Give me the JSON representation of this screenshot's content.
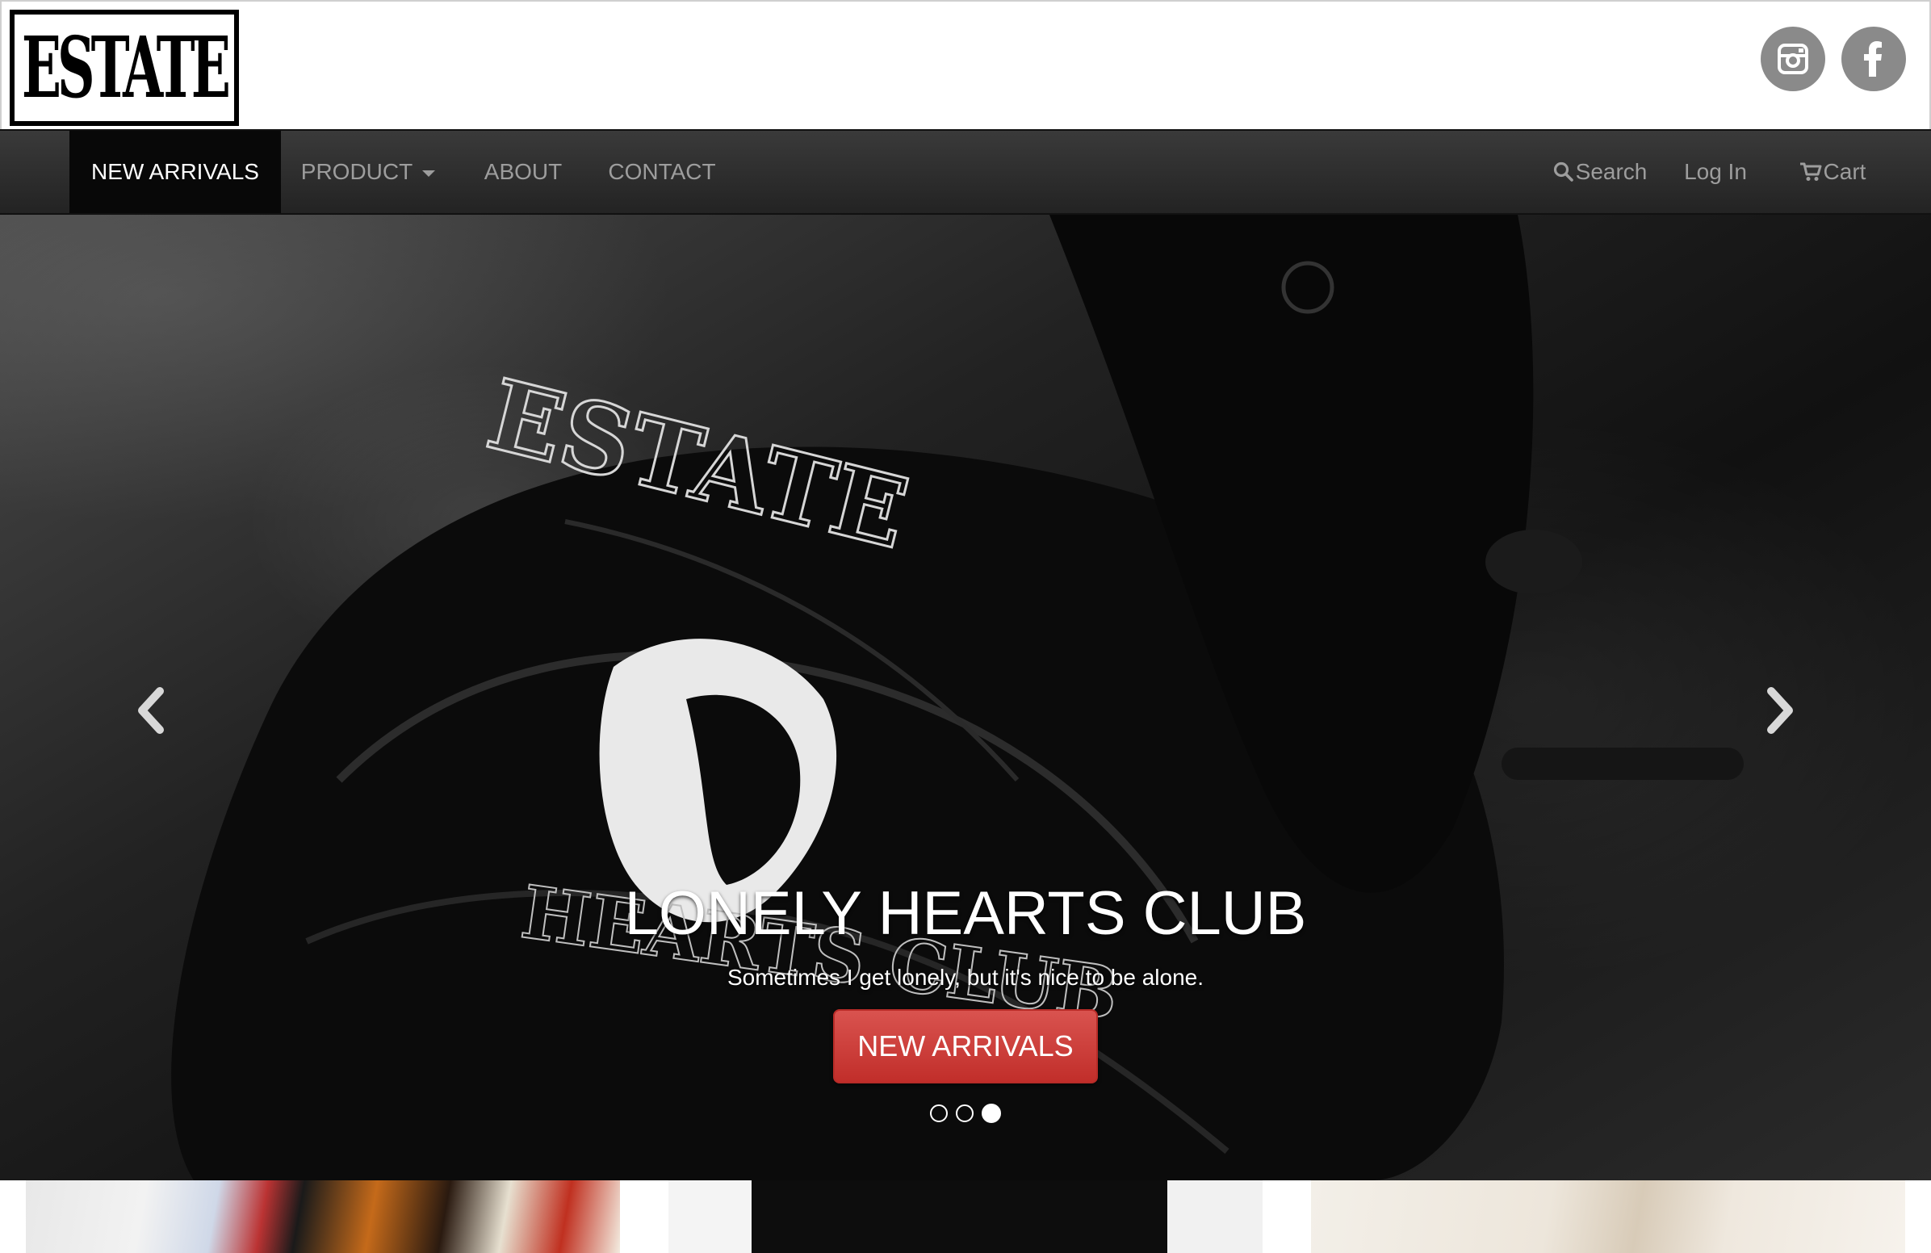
{
  "brand": {
    "logo_text": "ESTATE"
  },
  "social": {
    "instagram_icon": "instagram-icon",
    "facebook_icon": "facebook-icon"
  },
  "nav": {
    "new_arrivals": "NEW ARRIVALS",
    "product": "PRODUCT",
    "about": "ABOUT",
    "contact": "CONTACT",
    "search": "Search",
    "login": "Log In",
    "cart": "Cart"
  },
  "hero": {
    "title": "LONELY HEARTS CLUB",
    "subtitle": "Sometimes I get lonely, but it's nice to be alone.",
    "cta_label": "NEW ARRIVALS",
    "slide_count": 3,
    "active_slide": 3
  },
  "colors": {
    "accent": "#d9534f",
    "navbar": "#222222",
    "nav_active": "#080808",
    "social_icon_bg": "#8a8a8a"
  }
}
